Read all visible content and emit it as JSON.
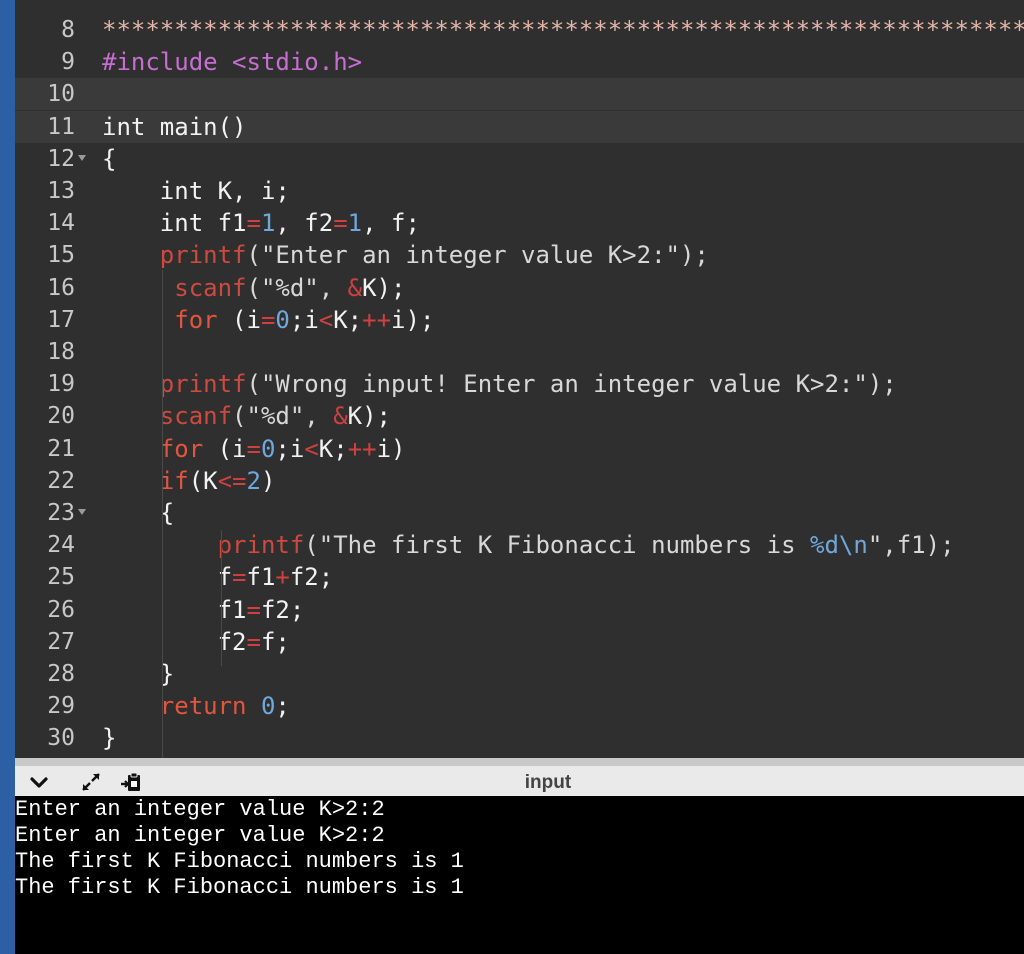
{
  "editor": {
    "lines": [
      {
        "num": "8",
        "fold": false,
        "tokens": [
          {
            "t": "*****************************************************************",
            "c": "t-cm"
          }
        ]
      },
      {
        "num": "9",
        "fold": false,
        "tokens": [
          {
            "t": "#include ",
            "c": "t-inc"
          },
          {
            "t": "<stdio.h>",
            "c": "t-inc"
          }
        ]
      },
      {
        "num": "10",
        "fold": false,
        "tokens": []
      },
      {
        "num": "11",
        "fold": false,
        "tokens": [
          {
            "t": "int main()",
            "c": "t-plain"
          }
        ]
      },
      {
        "num": "12",
        "fold": true,
        "tokens": [
          {
            "t": "{",
            "c": "t-plain"
          }
        ]
      },
      {
        "num": "13",
        "fold": false,
        "tokens": [
          {
            "t": "    int K, i;",
            "c": "t-plain"
          }
        ]
      },
      {
        "num": "14",
        "fold": false,
        "tokens": [
          {
            "t": "    int f1",
            "c": "t-plain"
          },
          {
            "t": "=",
            "c": "t-op"
          },
          {
            "t": "1",
            "c": "t-num"
          },
          {
            "t": ", f2",
            "c": "t-plain"
          },
          {
            "t": "=",
            "c": "t-op"
          },
          {
            "t": "1",
            "c": "t-num"
          },
          {
            "t": ", f;",
            "c": "t-plain"
          }
        ]
      },
      {
        "num": "15",
        "fold": false,
        "tokens": [
          {
            "t": "    ",
            "c": "t-plain"
          },
          {
            "t": "printf",
            "c": "t-fn"
          },
          {
            "t": "(\"Enter an integer value K>2:\");",
            "c": "t-str"
          }
        ]
      },
      {
        "num": "16",
        "fold": false,
        "tokens": [
          {
            "t": "     ",
            "c": "t-plain"
          },
          {
            "t": "scanf",
            "c": "t-fn"
          },
          {
            "t": "(\"%d\", ",
            "c": "t-str"
          },
          {
            "t": "&",
            "c": "t-op"
          },
          {
            "t": "K);",
            "c": "t-plain"
          }
        ]
      },
      {
        "num": "17",
        "fold": false,
        "tokens": [
          {
            "t": "     ",
            "c": "t-plain"
          },
          {
            "t": "for",
            "c": "t-kw"
          },
          {
            "t": " (i",
            "c": "t-plain"
          },
          {
            "t": "=",
            "c": "t-op"
          },
          {
            "t": "0",
            "c": "t-num"
          },
          {
            "t": ";i",
            "c": "t-plain"
          },
          {
            "t": "<",
            "c": "t-op"
          },
          {
            "t": "K;",
            "c": "t-plain"
          },
          {
            "t": "++",
            "c": "t-op"
          },
          {
            "t": "i);",
            "c": "t-plain"
          }
        ]
      },
      {
        "num": "18",
        "fold": false,
        "tokens": []
      },
      {
        "num": "19",
        "fold": false,
        "tokens": [
          {
            "t": "    ",
            "c": "t-plain"
          },
          {
            "t": "printf",
            "c": "t-fn"
          },
          {
            "t": "(\"Wrong input! Enter an integer value K>2:\");",
            "c": "t-str"
          }
        ]
      },
      {
        "num": "20",
        "fold": false,
        "tokens": [
          {
            "t": "    ",
            "c": "t-plain"
          },
          {
            "t": "scanf",
            "c": "t-fn"
          },
          {
            "t": "(\"%d\", ",
            "c": "t-str"
          },
          {
            "t": "&",
            "c": "t-op"
          },
          {
            "t": "K);",
            "c": "t-plain"
          }
        ]
      },
      {
        "num": "21",
        "fold": false,
        "tokens": [
          {
            "t": "    ",
            "c": "t-plain"
          },
          {
            "t": "for",
            "c": "t-kw"
          },
          {
            "t": " (i",
            "c": "t-plain"
          },
          {
            "t": "=",
            "c": "t-op"
          },
          {
            "t": "0",
            "c": "t-num"
          },
          {
            "t": ";i",
            "c": "t-plain"
          },
          {
            "t": "<",
            "c": "t-op"
          },
          {
            "t": "K;",
            "c": "t-plain"
          },
          {
            "t": "++",
            "c": "t-op"
          },
          {
            "t": "i)",
            "c": "t-plain"
          }
        ]
      },
      {
        "num": "22",
        "fold": false,
        "tokens": [
          {
            "t": "    ",
            "c": "t-plain"
          },
          {
            "t": "if",
            "c": "t-kw"
          },
          {
            "t": "(K",
            "c": "t-plain"
          },
          {
            "t": "<=",
            "c": "t-op"
          },
          {
            "t": "2",
            "c": "t-num"
          },
          {
            "t": ")",
            "c": "t-plain"
          }
        ]
      },
      {
        "num": "23",
        "fold": true,
        "tokens": [
          {
            "t": "    {",
            "c": "t-plain"
          }
        ]
      },
      {
        "num": "24",
        "fold": false,
        "tokens": [
          {
            "t": "        ",
            "c": "t-plain"
          },
          {
            "t": "printf",
            "c": "t-fn"
          },
          {
            "t": "(\"The first K Fibonacci numbers is ",
            "c": "t-str"
          },
          {
            "t": "%d\\n",
            "c": "t-num"
          },
          {
            "t": "\",f1);",
            "c": "t-str"
          }
        ]
      },
      {
        "num": "25",
        "fold": false,
        "tokens": [
          {
            "t": "        f",
            "c": "t-plain"
          },
          {
            "t": "=",
            "c": "t-op"
          },
          {
            "t": "f1",
            "c": "t-plain"
          },
          {
            "t": "+",
            "c": "t-op"
          },
          {
            "t": "f2;",
            "c": "t-plain"
          }
        ]
      },
      {
        "num": "26",
        "fold": false,
        "tokens": [
          {
            "t": "        f1",
            "c": "t-plain"
          },
          {
            "t": "=",
            "c": "t-op"
          },
          {
            "t": "f2;",
            "c": "t-plain"
          }
        ]
      },
      {
        "num": "27",
        "fold": false,
        "tokens": [
          {
            "t": "        f2",
            "c": "t-plain"
          },
          {
            "t": "=",
            "c": "t-op"
          },
          {
            "t": "f;",
            "c": "t-plain"
          }
        ]
      },
      {
        "num": "28",
        "fold": false,
        "tokens": [
          {
            "t": "    }",
            "c": "t-plain"
          }
        ]
      },
      {
        "num": "29",
        "fold": false,
        "tokens": [
          {
            "t": "    ",
            "c": "t-plain"
          },
          {
            "t": "return",
            "c": "t-kw"
          },
          {
            "t": " ",
            "c": "t-plain"
          },
          {
            "t": "0",
            "c": "t-num"
          },
          {
            "t": ";",
            "c": "t-plain"
          }
        ]
      },
      {
        "num": "30",
        "fold": false,
        "tokens": [
          {
            "t": "}",
            "c": "t-plain"
          }
        ]
      }
    ]
  },
  "toolbar": {
    "title": "input",
    "icons": [
      "chevron-down-icon",
      "expand-arrows-icon",
      "paste-icon"
    ]
  },
  "console": {
    "lines": [
      "Enter an integer value K>2:2",
      "Enter an integer value K>2:2",
      "The first K Fibonacci numbers is 1",
      "The first K Fibonacci numbers is 1"
    ]
  }
}
